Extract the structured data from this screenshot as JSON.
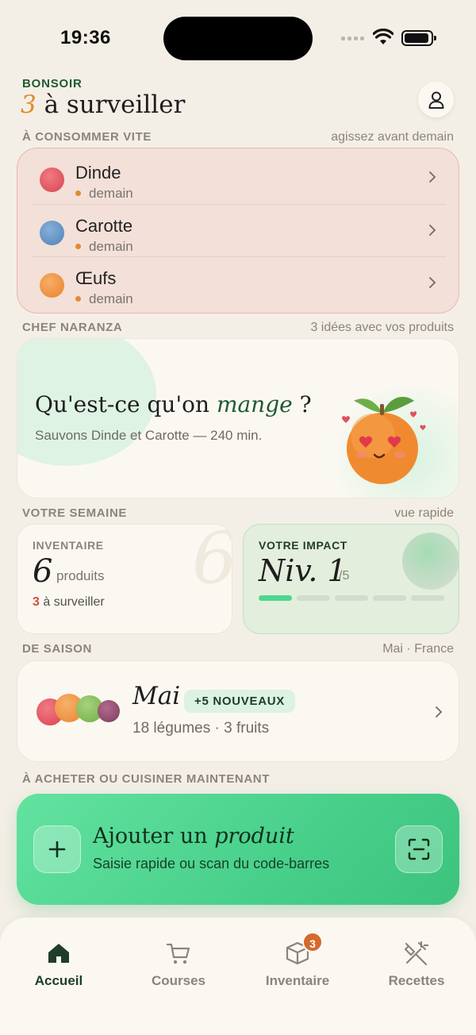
{
  "status_bar": {
    "time": "19:36"
  },
  "header": {
    "greeting": "BONSOIR",
    "watch_count": "3",
    "watch_text": " à surveiller"
  },
  "urgent": {
    "section_label": "À CONSOMMER VITE",
    "section_meta": "agissez avant demain",
    "items": [
      {
        "name": "Dinde",
        "when": "demain",
        "color": "#e0505e"
      },
      {
        "name": "Carotte",
        "when": "demain",
        "color": "#5b8fc5"
      },
      {
        "name": "Œufs",
        "when": "demain",
        "color": "#ee8c3a"
      }
    ]
  },
  "chef": {
    "section_label": "CHEF NARANZA",
    "section_meta": "3 idées avec vos produits",
    "title_start": "Qu'est-ce qu'on ",
    "title_em": "mange",
    "title_end": " ?",
    "subtitle": "Sauvons Dinde et Carotte — 240 min."
  },
  "week": {
    "section_label": "VOTRE SEMAINE",
    "section_meta": "vue rapide",
    "inventory": {
      "kicker": "INVENTAIRE",
      "watermark": "6",
      "count": "6",
      "unit": "produits",
      "watch_count": "3",
      "watch_text": " à surveiller"
    },
    "impact": {
      "kicker": "VOTRE IMPACT",
      "level": "Niv. 1",
      "max": "/5",
      "level_value": 1,
      "level_total": 5
    }
  },
  "season": {
    "section_label": "DE SAISON",
    "section_meta": "Mai · France",
    "month": "Mai",
    "badge": "+5 NOUVEAUX",
    "subtitle": "18 légumes · 3 fruits"
  },
  "action": {
    "section_label": "À ACHETER OU CUISINER MAINTENANT",
    "title_start": "Ajouter un ",
    "title_em": "produit",
    "subtitle": "Saisie rapide ou scan du code-barres"
  },
  "tabs": [
    {
      "label": "Accueil",
      "icon": "home-icon",
      "active": true
    },
    {
      "label": "Courses",
      "icon": "cart-icon",
      "active": false
    },
    {
      "label": "Inventaire",
      "icon": "box-icon",
      "active": false,
      "badge": "3"
    },
    {
      "label": "Recettes",
      "icon": "utensils-icon",
      "active": false
    }
  ],
  "colors": {
    "background": "#f4efe6",
    "brand_green": "#1f5a33",
    "accent_orange": "#e38a2d",
    "alert_red": "#d34b3b",
    "cta_green": "#48d08a"
  }
}
